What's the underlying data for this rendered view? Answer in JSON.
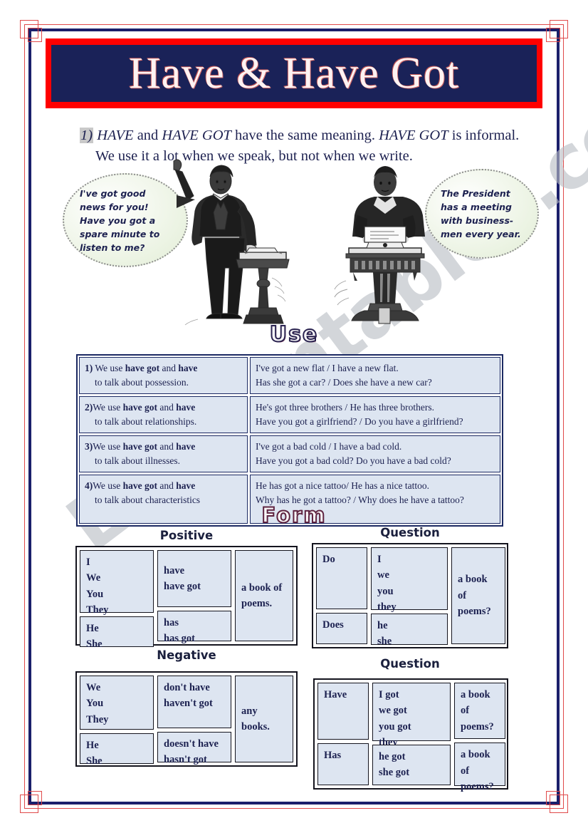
{
  "title": "Have & Have Got",
  "intro": {
    "number": "1)",
    "line1_pre": " ",
    "line1_em1": "HAVE",
    "line1_mid1": " and ",
    "line1_em2": "HAVE GOT",
    "line1_mid2": " have the same meaning. ",
    "line1_em3": "HAVE GOT",
    "line1_end": " is informal.",
    "line2": "We use it a lot when we speak, but not when we write."
  },
  "bubbles": {
    "left": "I've got good\nnews for you!\nHave you got a\nspare minute to\nlisten to me?",
    "right": "The President\nhas a meeting\nwith business-\nmen every year."
  },
  "headings": {
    "use": "Use",
    "form": "Form",
    "positive": "Positive",
    "negative": "Negative",
    "question_1": "Question",
    "question_2": "Question"
  },
  "use_table": {
    "rows": [
      {
        "rule_num": "1)",
        "rule_pre": " We use ",
        "rule_b1": "have got",
        "rule_mid": " and ",
        "rule_b2": "have",
        "rule_line2": "to talk about possession.",
        "examples": "I've got a new flat / I have a new flat.\nHas she got a car? / Does she have a  new car?"
      },
      {
        "rule_num": "2)",
        "rule_pre": "We use ",
        "rule_b1": "have got",
        "rule_mid": " and ",
        "rule_b2": "have",
        "rule_line2": "to talk about relationships.",
        "examples": "He's got three brothers / He has three brothers.\nHave you got a girlfriend? / Do you have a girlfriend?"
      },
      {
        "rule_num": "3)",
        "rule_pre": "We use ",
        "rule_b1": "have got",
        "rule_mid": " and ",
        "rule_b2": "have",
        "rule_line2": "to talk about illnesses.",
        "examples": "I've got a bad cold / I have a bad cold.\nHave you got a bad cold? Do you have a bad cold?"
      },
      {
        "rule_num": "4)",
        "rule_pre": "We use ",
        "rule_b1": "have got",
        "rule_mid": " and ",
        "rule_b2": "have",
        "rule_line2": "to talk about characteristics",
        "examples": "He has got a nice tattoo/ He  has a nice tattoo.\nWhy has he got a tattoo? / Why does he have a tattoo?"
      }
    ]
  },
  "form_tables": {
    "positive": {
      "subject_plural": "I\nWe\nYou\nThey",
      "verb_plural": "have\nhave got",
      "subject_singular": "He\nShe",
      "verb_singular": "has\nhas got",
      "object": "a book of\npoems."
    },
    "question_1": {
      "aux_plural": "Do",
      "subject_plural": "I\nwe\nyou\nthey",
      "aux_singular": "Does",
      "subject_singular": "he\nshe",
      "object": "a book\nof\npoems?"
    },
    "negative": {
      "subject_plural": "We\nYou\nThey",
      "verb_plural": "don't have\nhaven't got",
      "subject_singular": "He\nShe",
      "verb_singular": "doesn't have\nhasn't got",
      "object": "any\nbooks."
    },
    "question_2": {
      "aux_plural": "Have",
      "subject_plural": "I got\nwe got\nyou got\nthey",
      "object_plural": "a book\nof\npoems?",
      "aux_singular": "Has",
      "subject_singular": "he got\nshe got",
      "object_singular": "a book\nof\npoems?"
    }
  },
  "watermark": "ESLprintables.com",
  "colors": {
    "banner_border": "#ff0000",
    "banner_fill": "#1a2258",
    "banner_text": "#fdf3f3",
    "cell_fill": "#dde5f1",
    "cell_border": "#1c2a63",
    "ink": "#1c2150",
    "frame_navy": "#1b1f6b",
    "frame_red": "#e04a4a"
  }
}
